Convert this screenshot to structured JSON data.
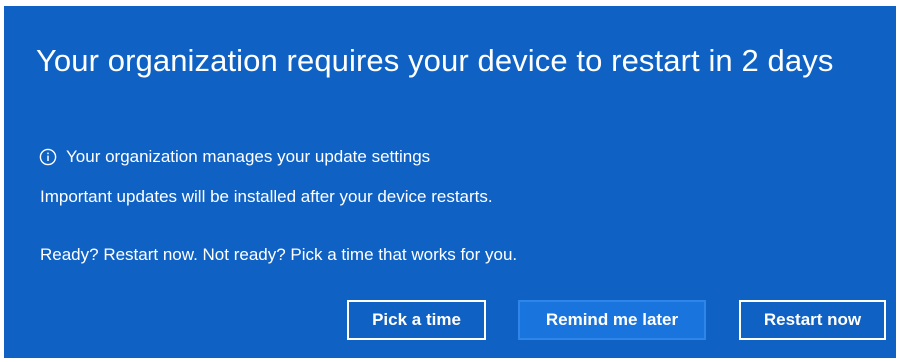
{
  "dialog": {
    "title": "Your organization requires your device to restart in 2 days",
    "managed_text": "Your organization manages your update settings",
    "info_icon": "info-icon",
    "important_text": "Important updates will be installed after your device restarts.",
    "ready_text": "Ready? Restart now. Not ready? Pick a time that works for you."
  },
  "buttons": {
    "pick_time": "Pick a time",
    "remind_later": "Remind me later",
    "restart_now": "Restart now"
  },
  "colors": {
    "background": "#0f62c4",
    "text": "#ffffff",
    "focused_button": "#1a74de"
  }
}
